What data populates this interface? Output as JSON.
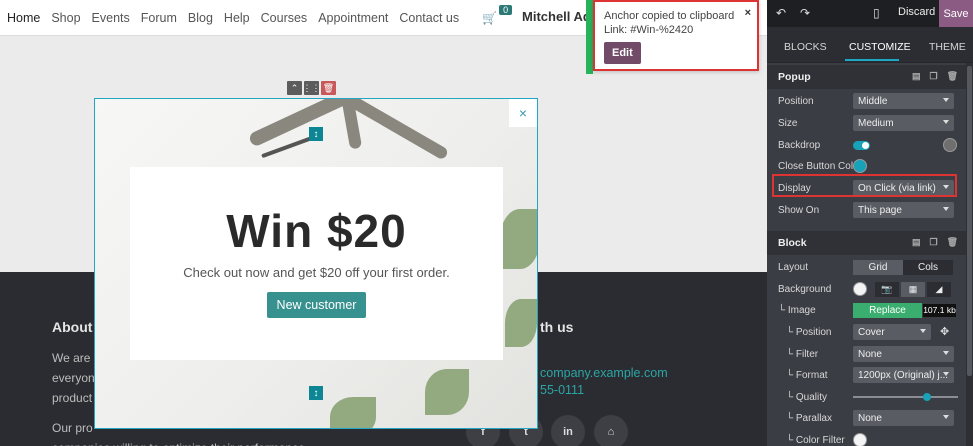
{
  "nav": {
    "items": [
      "Home",
      "Shop",
      "Events",
      "Forum",
      "Blog",
      "Help",
      "Courses",
      "Appointment",
      "Contact us"
    ],
    "cart_count": "0",
    "brand": "Mitchell Ad"
  },
  "footer": {
    "about_title": "About",
    "about_text": "We are a\neveryon\nproduct",
    "about_text2": "Our pro\ncompanies willing to optimize their performance.",
    "contact_title": "th us",
    "contact_email": "company.example.com",
    "contact_phone": "55-0111",
    "social": [
      "f",
      "t",
      "in",
      "home"
    ]
  },
  "popup": {
    "title": "Win $20",
    "subtitle": "Check out now and get $20 off your first order.",
    "button": "New customer",
    "close": "×"
  },
  "toast": {
    "line1": "Anchor copied to clipboard",
    "line2": "Link: #Win-%2420",
    "close": "×",
    "edit": "Edit"
  },
  "panel": {
    "topbar": {
      "discard": "Discard",
      "save": "Save"
    },
    "tabs": [
      "BLOCKS",
      "CUSTOMIZE",
      "THEME"
    ],
    "active_tab": "CUSTOMIZE",
    "popup_section": {
      "title": "Popup",
      "rows": [
        {
          "label": "Position",
          "value": "Middle"
        },
        {
          "label": "Size",
          "value": "Medium"
        },
        {
          "label": "Backdrop"
        },
        {
          "label": "Close Button Col..."
        },
        {
          "label": "Display",
          "value": "On Click (via link)"
        },
        {
          "label": "Show On",
          "value": "This page"
        }
      ]
    },
    "block_section": {
      "title": "Block",
      "layout_label": "Layout",
      "layout_options": [
        "Grid",
        "Cols"
      ],
      "layout_selected": "Cols",
      "background_label": "Background",
      "image_label": "└ Image",
      "replace": "Replace",
      "image_size": "107.1 kb",
      "position_label": "└ Position",
      "position_value": "Cover",
      "filter_label": "└ Filter",
      "filter_value": "None",
      "format_label": "└ Format",
      "format_value": "1200px (Original) j...",
      "quality_label": "└ Quality",
      "quality_value": 0.7,
      "parallax_label": "└ Parallax",
      "parallax_value": "None",
      "colorfilter_label": "└ Color Filter"
    },
    "colors": {
      "accent": "#17a2b8",
      "save": "#8c5b84",
      "highlight": "#dd3333",
      "replace": "#3aae6e"
    }
  }
}
